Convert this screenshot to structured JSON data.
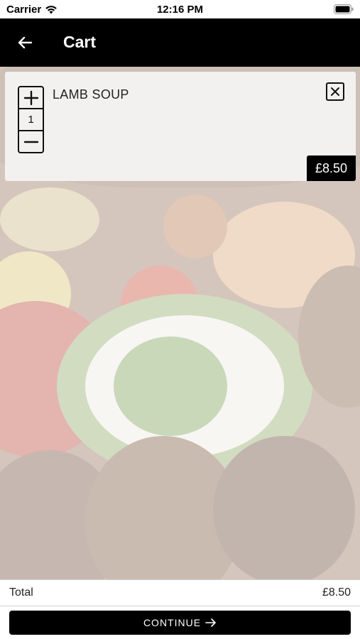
{
  "status_bar": {
    "carrier": "Carrier",
    "time": "12:16 PM",
    "icons": [
      "wifi-icon",
      "battery-icon"
    ]
  },
  "nav": {
    "back_icon": "arrow-left-icon",
    "title": "Cart"
  },
  "cart": {
    "items": [
      {
        "name": "LAMB SOUP",
        "quantity": "1",
        "price": "£8.50",
        "increment_icon": "plus-icon",
        "decrement_icon": "minus-icon",
        "remove_icon": "close-icon"
      }
    ]
  },
  "footer": {
    "total_label": "Total",
    "total_value": "£8.50",
    "continue_label": "CONTINUE",
    "continue_icon": "arrow-right-icon"
  },
  "colors": {
    "nav_background": "#000000",
    "button_background": "#000000",
    "card_background": "#f4f4f4",
    "text": "#222222"
  }
}
